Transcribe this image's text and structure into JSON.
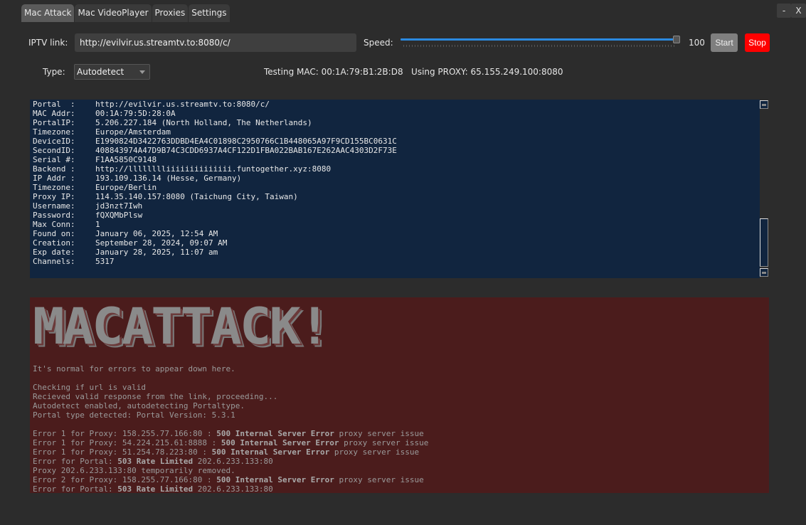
{
  "window": {
    "minimize_label": "-",
    "close_label": "X"
  },
  "tabs": [
    {
      "label": "Mac Attack",
      "active": true
    },
    {
      "label": "Mac VideoPlayer",
      "active": false
    },
    {
      "label": "Proxies",
      "active": false
    },
    {
      "label": "Settings",
      "active": false
    }
  ],
  "controls": {
    "iptv_label": "IPTV link:",
    "iptv_value": "http://evilvir.us.streamtv.to:8080/c/",
    "speed_label": "Speed:",
    "speed_value": "100",
    "speed_fraction": 1.0,
    "start_label": "Start",
    "stop_label": "Stop",
    "type_label": "Type:",
    "type_value": "Autodetect",
    "status_text": "Testing MAC: 00:1A:79:B1:2B:D8   Using PROXY: 65.155.249.100:8080"
  },
  "colors": {
    "stop_button": "#ff0000",
    "slider_fill": "#2b8ae0",
    "info_bg": "#11253f",
    "log_bg": "#4b1c1c"
  },
  "info": [
    {
      "key": "Portal  :",
      "value": "http://evilvir.us.streamtv.to:8080/c/"
    },
    {
      "key": "MAC Addr:",
      "value": "00:1A:79:5D:28:0A"
    },
    {
      "key": "PortalIP:",
      "value": "5.206.227.184 (North Holland, The Netherlands)"
    },
    {
      "key": "Timezone:",
      "value": "Europe/Amsterdam"
    },
    {
      "key": "DeviceID:",
      "value": "E1990824D3422763DDBD4EA4C01898C2950766C1B448065A97F9CD155BC0631C"
    },
    {
      "key": "SecondID:",
      "value": "408843974A47D9B74C3CDD6937A4CF122D1FBA022BAB167E262AAC4303D2F73E"
    },
    {
      "key": "Serial #:",
      "value": "F1AA5850C9148"
    },
    {
      "key": "Backend :",
      "value": "http://lllllllliiiiiiiiiiiiii.funtogether.xyz:8080"
    },
    {
      "key": "IP Addr :",
      "value": "193.109.136.14 (Hesse, Germany)"
    },
    {
      "key": "Timezone:",
      "value": "Europe/Berlin"
    },
    {
      "key": "Proxy IP:",
      "value": "114.35.140.157:8080 (Taichung City, Taiwan)"
    },
    {
      "key": "Username:",
      "value": "jd3nzt7Iwh"
    },
    {
      "key": "Password:",
      "value": "fQXQMbPlsw"
    },
    {
      "key": "Max Conn:",
      "value": "1"
    },
    {
      "key": "Found on:",
      "value": "January 06, 2025, 12:54 AM"
    },
    {
      "key": "Creation:",
      "value": "September 28, 2024, 09:07 AM"
    },
    {
      "key": "Exp date:",
      "value": "January 28, 2025, 11:07 am"
    },
    {
      "key": "Channels:",
      "value": "5317"
    }
  ],
  "log": {
    "banner": "MACATTACK!",
    "lines": [
      {
        "pre": "It's normal for errors to appear down here.",
        "bold": "",
        "post": ""
      },
      {
        "pre": "",
        "bold": "",
        "post": ""
      },
      {
        "pre": "Checking if url is valid",
        "bold": "",
        "post": ""
      },
      {
        "pre": "Recieved valid response from the link, proceeding...",
        "bold": "",
        "post": ""
      },
      {
        "pre": "Autodetect enabled, autodetecting Portaltype.",
        "bold": "",
        "post": ""
      },
      {
        "pre": "Portal type detected: Portal Version: 5.3.1",
        "bold": "",
        "post": ""
      },
      {
        "pre": "",
        "bold": "",
        "post": ""
      },
      {
        "pre": "Error 1 for Proxy: 158.255.77.166:80 : ",
        "bold": "500 Internal Server Error",
        "post": " proxy server issue"
      },
      {
        "pre": "Error 1 for Proxy: 54.224.215.61:8888 : ",
        "bold": "500 Internal Server Error",
        "post": " proxy server issue"
      },
      {
        "pre": "Error 1 for Proxy: 51.254.78.223:80 : ",
        "bold": "500 Internal Server Error",
        "post": " proxy server issue"
      },
      {
        "pre": "Error for Portal: ",
        "bold": "503 Rate Limited",
        "post": " 202.6.233.133:80"
      },
      {
        "pre": "Proxy 202.6.233.133:80 temporarily removed.",
        "bold": "",
        "post": ""
      },
      {
        "pre": "Error 2 for Proxy: 158.255.77.166:80 : ",
        "bold": "500 Internal Server Error",
        "post": " proxy server issue"
      },
      {
        "pre": "Error for Portal: ",
        "bold": "503 Rate Limited",
        "post": " 202.6.233.133:80"
      }
    ]
  }
}
